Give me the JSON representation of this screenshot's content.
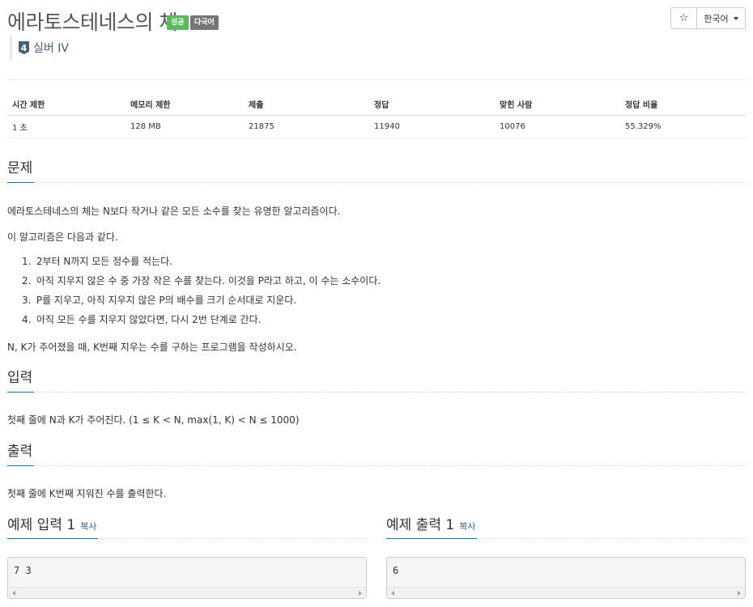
{
  "problem": {
    "title": "에라토스테네스의 체",
    "badges": {
      "success": "성공",
      "multilang": "다국어"
    },
    "tier": {
      "number": "4",
      "label": "실버 IV"
    }
  },
  "toolbar": {
    "star_icon": "star-icon",
    "star_glyph": "☆",
    "language": "한국어"
  },
  "info": {
    "headers": [
      "시간 제한",
      "메모리 제한",
      "제출",
      "정답",
      "맞힌 사람",
      "정답 비율"
    ],
    "values": [
      "1 초",
      "128 MB",
      "21875",
      "11940",
      "10076",
      "55.329%"
    ]
  },
  "description": {
    "heading": "문제",
    "intro": "에라토스테네스의 체는 N보다 작거나 같은 모든 소수를 찾는 유명한 알고리즘이다.",
    "algo_intro": "이 알고리즘은 다음과 같다.",
    "steps": [
      {
        "num": "1.",
        "text": "2부터 N까지 모든 정수를 적는다."
      },
      {
        "num": "2.",
        "text": "아직 지우지 않은 수 중 가장 작은 수를 찾는다. 이것을 P라고 하고, 이 수는 소수이다."
      },
      {
        "num": "3.",
        "text": "P를 지우고, 아직 지우지 않은 P의 배수를 크기 순서대로 지운다."
      },
      {
        "num": "4.",
        "text": "아직 모든 수를 지우지 않았다면, 다시 2번 단계로 간다."
      }
    ],
    "task": "N, K가 주어졌을 때, K번째 지우는 수를 구하는 프로그램을 작성하시오."
  },
  "input": {
    "heading": "입력",
    "text": "첫째 줄에 N과 K가 주어진다. (1 ≤ K < N, max(1, K) < N ≤ 1000)"
  },
  "output": {
    "heading": "출력",
    "text": "첫째 줄에 K번째 지워진 수를 출력한다."
  },
  "samples": {
    "input_title": "예제 입력 1",
    "output_title": "예제 출력 1",
    "copy_label": "복사",
    "input_value": "7 3",
    "output_value": "6"
  }
}
